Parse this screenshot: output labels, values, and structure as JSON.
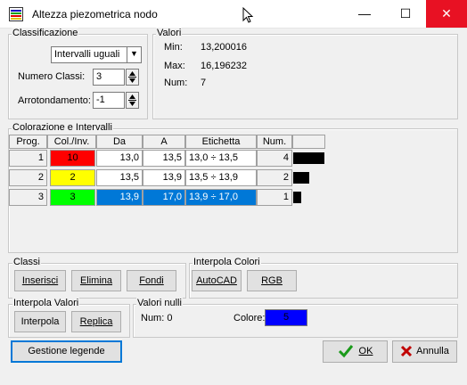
{
  "window": {
    "title": "Altezza piezometrica nodo",
    "minimize": "—",
    "maximize": "☐",
    "close": "✕"
  },
  "classificazione": {
    "legend": "Classificazione",
    "method": "Intervalli uguali",
    "numero_classi_label": "Numero Classi:",
    "numero_classi_value": "3",
    "arrotondamento_label": "Arrotondamento:",
    "arrotondamento_value": "-1"
  },
  "valori": {
    "legend": "Valori",
    "min_label": "Min:",
    "min_value": "13,200016",
    "max_label": "Max:",
    "max_value": "16,196232",
    "num_label": "Num:",
    "num_value": "7"
  },
  "colorazione": {
    "legend": "Colorazione e Intervalli",
    "columns": [
      "Prog.",
      "Col./Inv.",
      "Da",
      "A",
      "Etichetta",
      "Num."
    ],
    "rows": [
      {
        "prog": "1",
        "col_label": "10",
        "color": "#ff0000",
        "da": "13,0",
        "a": "13,5",
        "etichetta": "13,0 ÷ 13,5",
        "num": "4",
        "count": 4
      },
      {
        "prog": "2",
        "col_label": "2",
        "color": "#ffff00",
        "da": "13,5",
        "a": "13,9",
        "etichetta": "13,5 ÷ 13,9",
        "num": "2",
        "count": 2
      },
      {
        "prog": "3",
        "col_label": "3",
        "color": "#00ff00",
        "da": "13,9",
        "a": "17,0",
        "etichetta": "13,9 ÷ 17,0",
        "num": "1",
        "count": 1
      }
    ]
  },
  "classi": {
    "legend": "Classi",
    "inserisci": "Inserisci",
    "elimina": "Elimina",
    "fondi": "Fondi"
  },
  "interpola_colori": {
    "legend": "Interpola Colori",
    "autocad": "AutoCAD",
    "rgb": "RGB"
  },
  "interpola_valori": {
    "legend": "Interpola Valori",
    "interpola": "Interpola",
    "replica": "Replica"
  },
  "valori_nulli": {
    "legend": "Valori nulli",
    "num_label": "Num: 0",
    "colore_label": "Colore:",
    "colore_value": "5",
    "colore": "#0000ff"
  },
  "footer": {
    "gestione_legende": "Gestione legende",
    "ok": "OK",
    "annulla": "Annulla"
  },
  "colors": {
    "selection": "#0078d7",
    "accent": "#0078d7"
  }
}
